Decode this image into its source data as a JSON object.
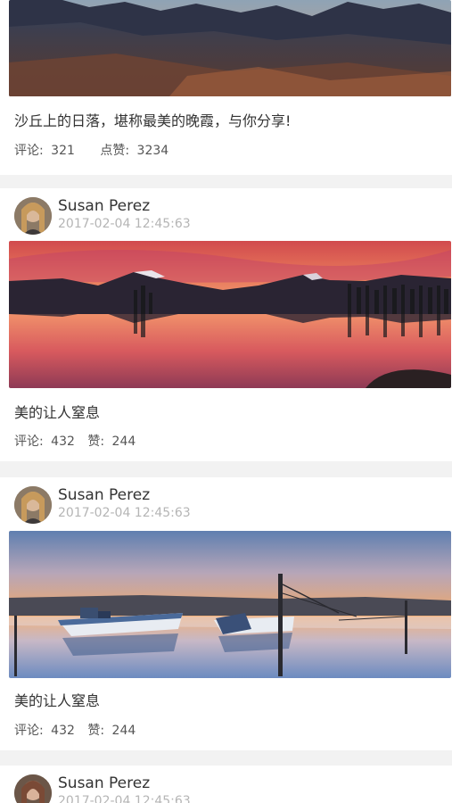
{
  "posts": [
    {
      "title": "沙丘上的日落，堪称最美的晚霞，与你分享!",
      "comments_label": "评论:",
      "comments": "321",
      "likes_label": "点赞:",
      "likes": "3234",
      "image": "mountain-valley-photo"
    },
    {
      "author": "Susan Perez",
      "time": "2017-02-04  12:45:63",
      "image": "sunset-lake-photo",
      "title": "美的让人窒息",
      "comments_label": "评论:",
      "comments": "432",
      "likes_label": "赞:",
      "likes": "244"
    },
    {
      "author": "Susan Perez",
      "time": "2017-02-04  12:45:63",
      "image": "boats-dawn-photo",
      "title": "美的让人窒息",
      "comments_label": "评论:",
      "comments": "432",
      "likes_label": "赞:",
      "likes": "244"
    },
    {
      "author": "Susan Perez",
      "time": "2017-02-04  12:45:63"
    }
  ]
}
